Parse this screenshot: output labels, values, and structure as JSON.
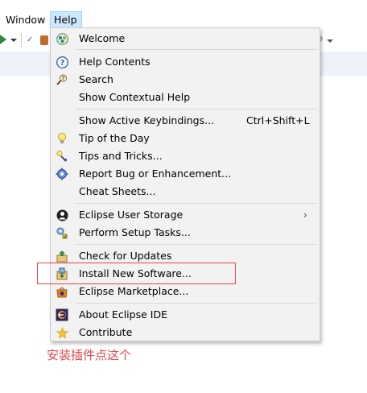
{
  "menubar": {
    "window_label": "Window",
    "help_label": "Help"
  },
  "help_menu": {
    "items": [
      {
        "label": "Welcome",
        "icon": "welcome-icon"
      },
      {
        "label": "Help Contents",
        "icon": "help-contents-icon"
      },
      {
        "label": "Search",
        "icon": "search-icon"
      },
      {
        "label": "Show Contextual Help",
        "icon": ""
      },
      {
        "label": "Show Active Keybindings...",
        "accelerator": "Ctrl+Shift+L",
        "icon": ""
      },
      {
        "label": "Tip of the Day",
        "icon": "lightbulb-icon"
      },
      {
        "label": "Tips and Tricks...",
        "icon": "tips-tricks-icon"
      },
      {
        "label": "Report Bug or Enhancement...",
        "icon": "report-bug-icon"
      },
      {
        "label": "Cheat Sheets...",
        "icon": ""
      },
      {
        "label": "Eclipse User Storage",
        "icon": "user-storage-icon",
        "submenu": true
      },
      {
        "label": "Perform Setup Tasks...",
        "icon": "setup-tasks-icon"
      },
      {
        "label": "Check for Updates",
        "icon": "check-updates-icon"
      },
      {
        "label": "Install New Software...",
        "icon": "install-software-icon"
      },
      {
        "label": "Eclipse Marketplace...",
        "icon": "marketplace-icon"
      },
      {
        "label": "About Eclipse IDE",
        "icon": "eclipse-about-icon"
      },
      {
        "label": "Contribute",
        "icon": "star-icon"
      }
    ]
  },
  "annotation": {
    "note_text": "安装插件点这个",
    "highlight_color": "#e0474c"
  }
}
